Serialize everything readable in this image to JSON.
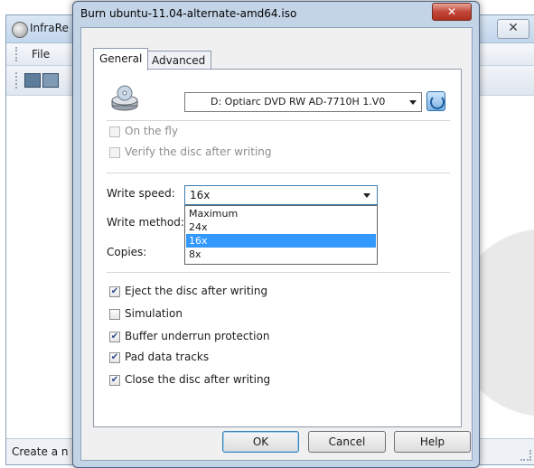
{
  "background_app": {
    "title": "InfraRe",
    "menu": {
      "file": "File"
    },
    "status_text": "Create a n",
    "close_symbol": "✕"
  },
  "dialog": {
    "title": "Burn ubuntu-11.04-alternate-amd64.iso",
    "close_symbol": "✕",
    "tabs": [
      {
        "label": "General",
        "selected": true
      },
      {
        "label": "Advanced",
        "selected": false
      }
    ],
    "drive": {
      "value": "D: Optiarc DVD RW AD-7710H 1.V0",
      "icon": "cd-drive-icon"
    },
    "options_top": [
      {
        "label": "On the fly",
        "checked": false,
        "enabled": false
      },
      {
        "label": "Verify the disc after writing",
        "checked": false,
        "enabled": false
      }
    ],
    "write_speed": {
      "label": "Write speed:",
      "value": "16x",
      "options": [
        "Maximum",
        "24x",
        "16x",
        "8x"
      ],
      "selected_index": 2
    },
    "write_method": {
      "label": "Write method:"
    },
    "copies": {
      "label": "Copies:"
    },
    "options_bottom": [
      {
        "label": "Eject the disc after writing",
        "checked": true
      },
      {
        "label": "Simulation",
        "checked": false
      },
      {
        "label": "Buffer underrun protection",
        "checked": true
      },
      {
        "label": "Pad data tracks",
        "checked": true
      },
      {
        "label": "Close the disc after writing",
        "checked": true
      }
    ],
    "check_mark": "✔",
    "buttons": {
      "ok": "OK",
      "cancel": "Cancel",
      "help": "Help"
    }
  },
  "colors": {
    "selection": "#3399ff",
    "dialog_frame": "#c4d4e7",
    "close_button": "#c2473a"
  }
}
